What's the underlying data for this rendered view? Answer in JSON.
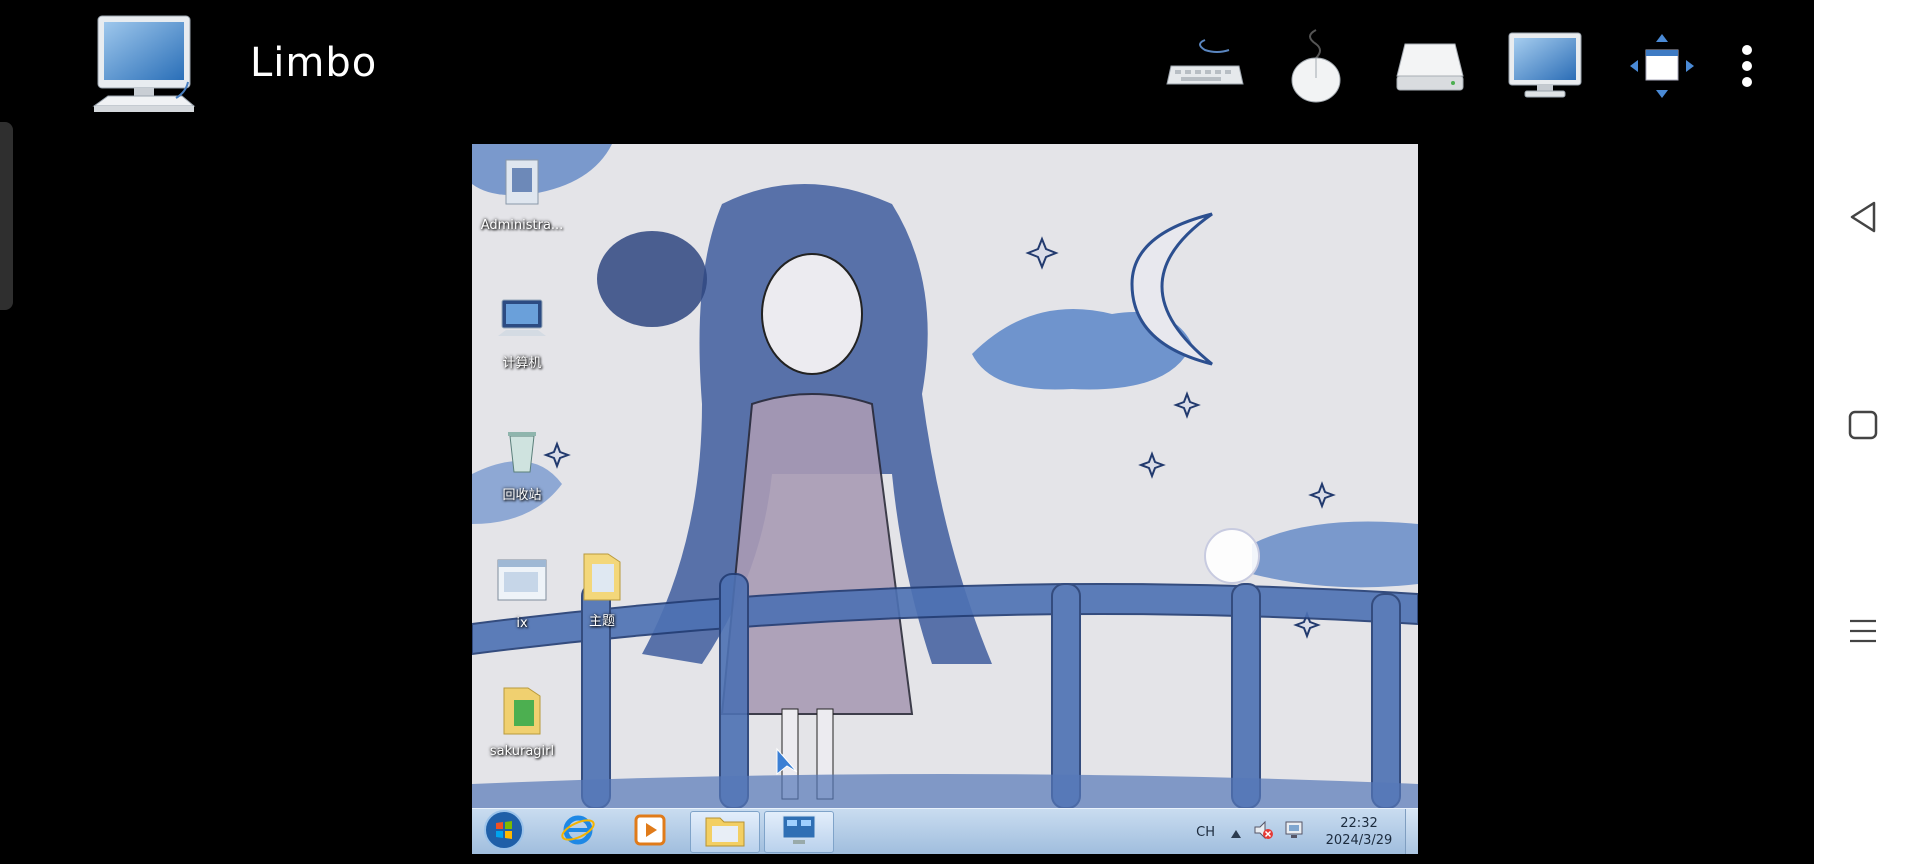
{
  "app": {
    "title": "Limbo",
    "icon": "computer-monitor-icon"
  },
  "toolbar": {
    "buttons": [
      {
        "name": "keyboard-button",
        "icon": "keyboard-icon"
      },
      {
        "name": "mouse-button",
        "icon": "mouse-icon"
      },
      {
        "name": "drive-button",
        "icon": "disk-drive-icon"
      },
      {
        "name": "display-button",
        "icon": "monitor-icon"
      },
      {
        "name": "fit-screen-button",
        "icon": "resize-arrows-icon"
      },
      {
        "name": "more-options-button",
        "icon": "more-vert-icon"
      }
    ]
  },
  "desktop": {
    "icons": [
      {
        "name": "desktop-icon-administrator",
        "label": "Administra...",
        "icon": "user-folder-icon"
      },
      {
        "name": "desktop-icon-computer",
        "label": "计算机",
        "icon": "computer-icon"
      },
      {
        "name": "desktop-icon-recycle-bin",
        "label": "回收站",
        "icon": "recycle-bin-icon"
      },
      {
        "name": "desktop-icon-ix",
        "label": "ix",
        "icon": "window-icon"
      },
      {
        "name": "desktop-icon-theme",
        "label": "主题",
        "icon": "folder-icon"
      },
      {
        "name": "desktop-icon-sakuragirl",
        "label": "sakuragirl",
        "icon": "folder-icon"
      }
    ]
  },
  "taskbar": {
    "items": [
      {
        "name": "start-button",
        "icon": "windows-start-icon"
      },
      {
        "name": "taskbar-ie",
        "icon": "internet-explorer-icon"
      },
      {
        "name": "taskbar-media-player",
        "icon": "media-player-icon"
      },
      {
        "name": "taskbar-explorer",
        "icon": "file-explorer-icon"
      },
      {
        "name": "taskbar-control-panel",
        "icon": "control-panel-icon"
      }
    ],
    "tray": {
      "language": "CH",
      "time": "22:32",
      "date": "2024/3/29"
    }
  },
  "navbar": {
    "buttons": [
      {
        "name": "back-button",
        "icon": "back-triangle-icon"
      },
      {
        "name": "home-button",
        "icon": "home-square-icon"
      },
      {
        "name": "recents-button",
        "icon": "recents-lines-icon"
      }
    ]
  },
  "colors": {
    "background": "#000000",
    "taskbar": "#b3cce8",
    "navbar": "#ffffff",
    "wallpaper_ink": "#3a5a9c"
  }
}
